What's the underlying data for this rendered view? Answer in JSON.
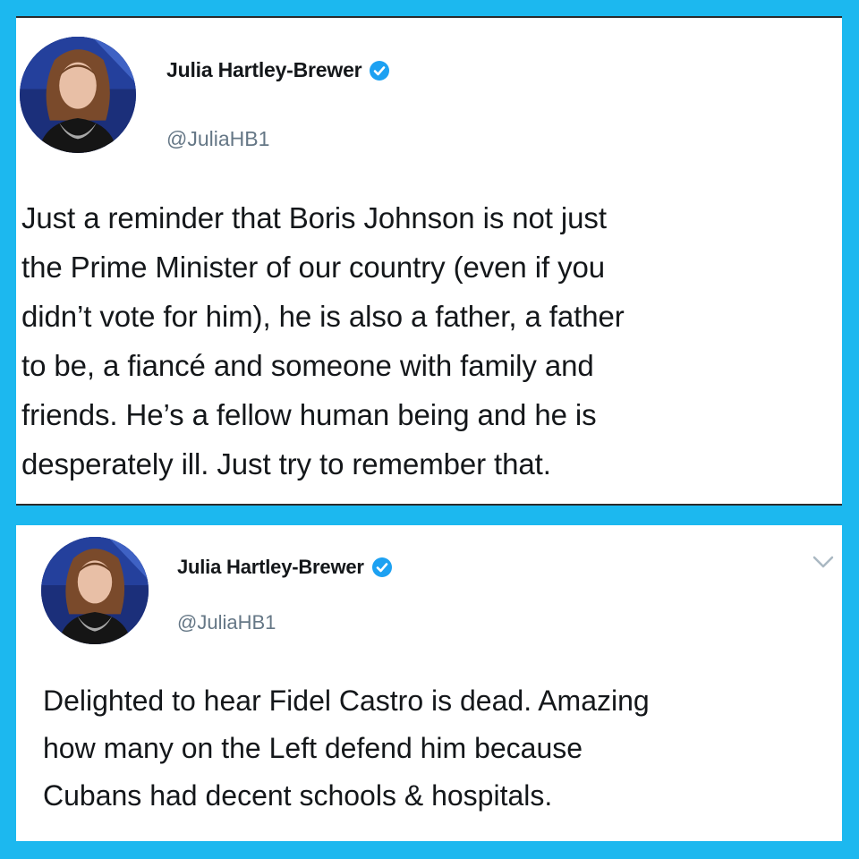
{
  "tweets": [
    {
      "display_name": "Julia Hartley-Brewer",
      "handle": "@JuliaHB1",
      "verified": true,
      "avatar_icon": "profile-photo",
      "text": "Just a reminder that Boris Johnson is not just\nthe Prime Minister of our country (even if you\ndidn’t vote for him), he is also a father, a father\nto be, a fiancé and someone with family and\nfriends. He’s a fellow human being and he is\ndesperately ill. Just try to remember that."
    },
    {
      "display_name": "Julia Hartley-Brewer",
      "handle": "@JuliaHB1",
      "verified": true,
      "avatar_icon": "profile-photo",
      "menu_icon": "chevron-down-icon",
      "text": "Delighted to hear Fidel Castro is dead. Amazing\nhow many on the Left defend him because\nCubans had decent schools & hospitals."
    }
  ],
  "colors": {
    "frame": "#1cb8ef",
    "card": "#ffffff",
    "name": "#14171a",
    "handle": "#657786",
    "verified": "#1da1f2",
    "chevron": "#aab8c2"
  }
}
